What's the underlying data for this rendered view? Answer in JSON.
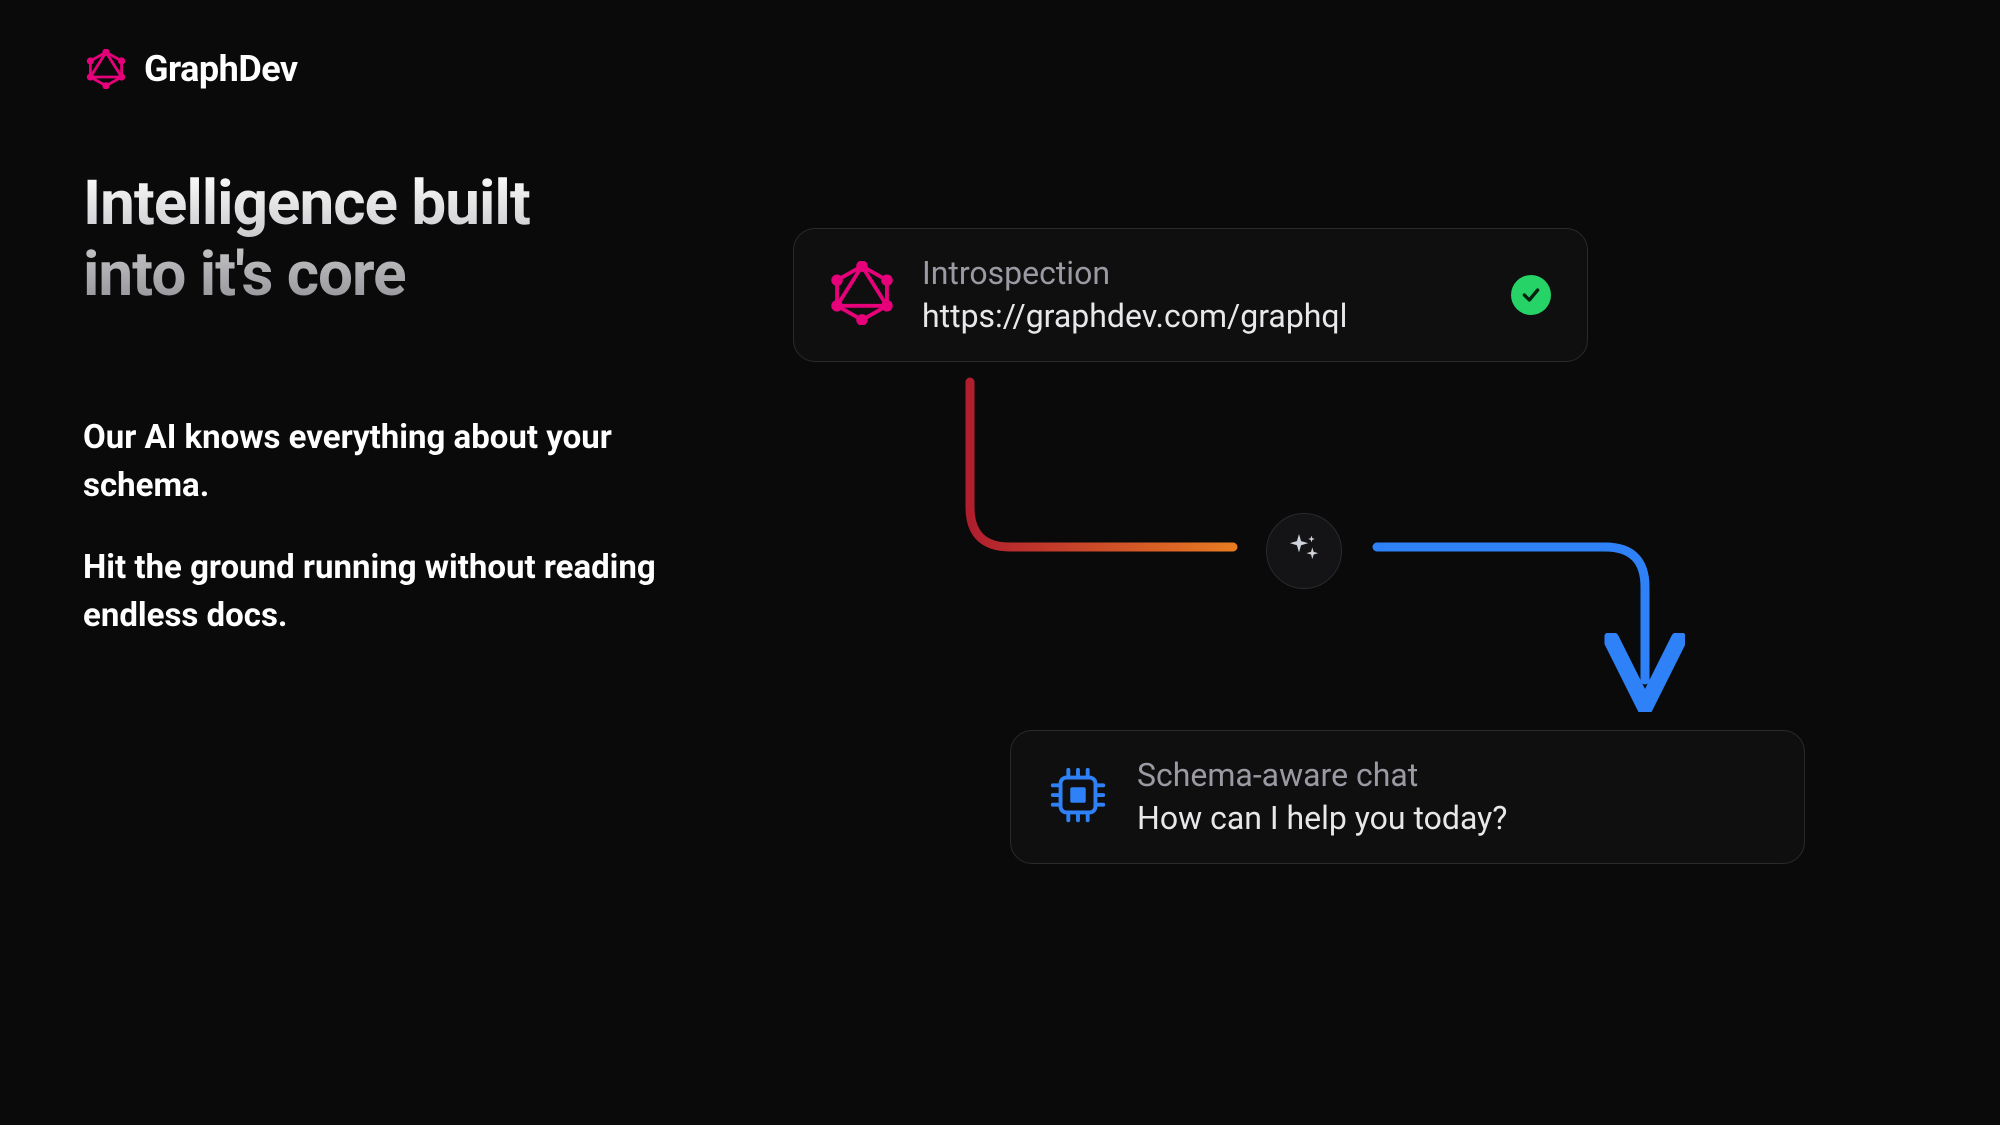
{
  "brand": {
    "name": "GraphDev"
  },
  "headline": {
    "line1": "Intelligence built",
    "line2": "into it's core"
  },
  "body": {
    "p1": "Our AI knows everything about your schema.",
    "p2": "Hit the ground running without reading endless docs."
  },
  "cards": {
    "introspection": {
      "title": "Introspection",
      "subtitle": "https://graphdev.com/graphql"
    },
    "chat": {
      "title": "Schema-aware chat",
      "subtitle": "How can I help you today?"
    }
  },
  "colors": {
    "pink": "#e6007a",
    "blue": "#2f81f7",
    "green": "#25d366"
  }
}
